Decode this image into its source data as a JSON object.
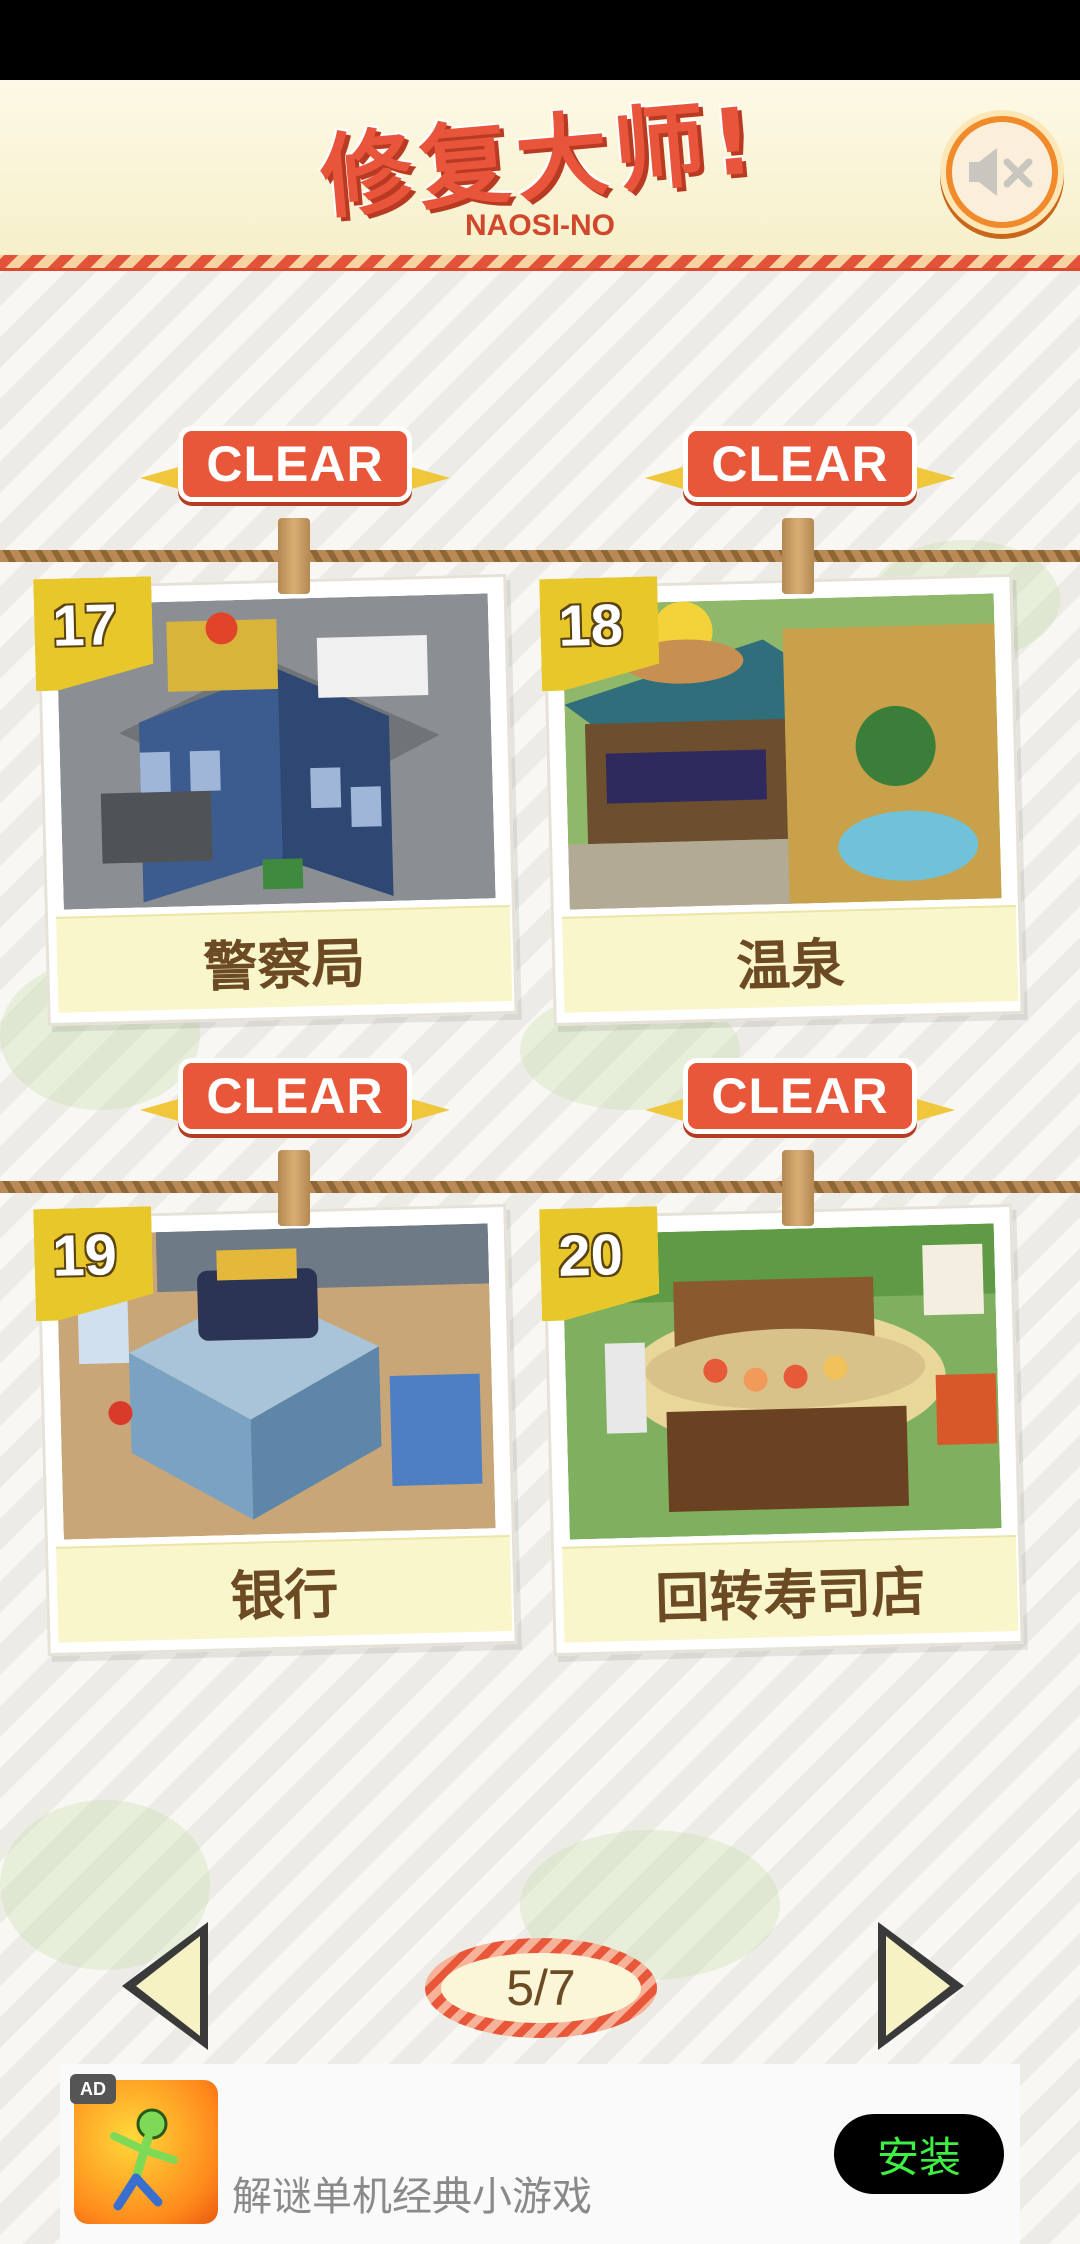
{
  "header": {
    "logo_cn": "修复大师!",
    "logo_en": "NAOSI-NO",
    "sound_icon": "speaker-muted-icon"
  },
  "levels": [
    {
      "number": "17",
      "label": "警察局",
      "status": "CLEAR"
    },
    {
      "number": "18",
      "label": "温泉",
      "status": "CLEAR"
    },
    {
      "number": "19",
      "label": "银行",
      "status": "CLEAR"
    },
    {
      "number": "20",
      "label": "回转寿司店",
      "status": "CLEAR"
    }
  ],
  "pager": {
    "text": "5/7"
  },
  "ad": {
    "tag": "AD",
    "text": "解谜单机经典小游戏",
    "button": "安装"
  },
  "colors": {
    "accent_red": "#e9573a",
    "badge_yellow": "#e7c72a",
    "label_bg": "#f9f6cc",
    "install_green": "#3ff044"
  }
}
